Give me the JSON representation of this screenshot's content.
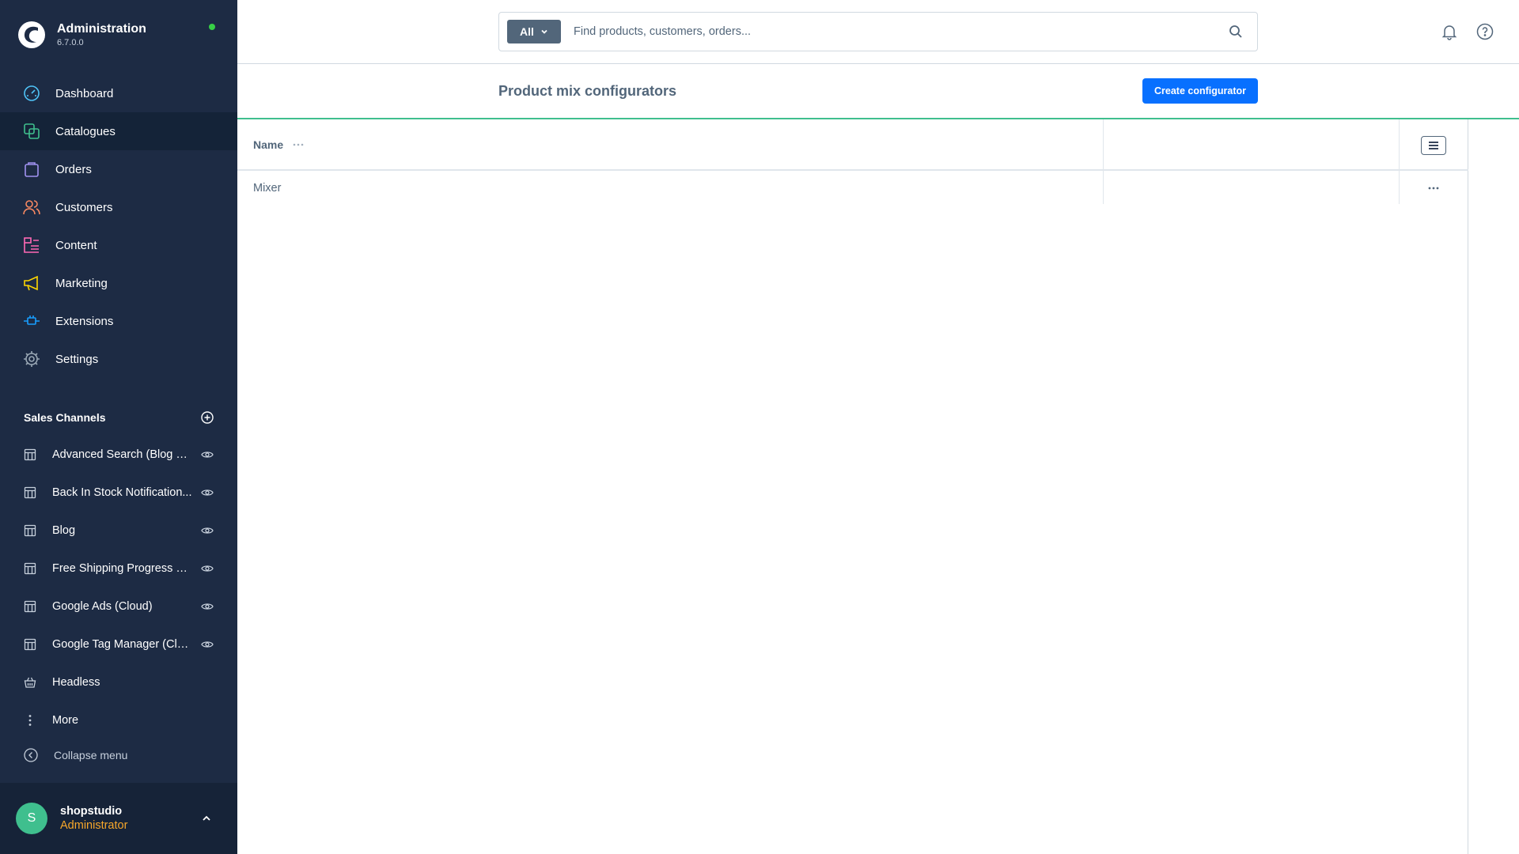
{
  "brand": {
    "title": "Administration",
    "version": "6.7.0.0",
    "status_color": "#37d046"
  },
  "nav": {
    "items": [
      {
        "label": "Dashboard",
        "icon": "dashboard-gauge-icon",
        "color": "#4fc3f7"
      },
      {
        "label": "Catalogues",
        "icon": "catalogues-icon",
        "color": "#3fbf8e"
      },
      {
        "label": "Orders",
        "icon": "orders-bag-icon",
        "color": "#a092f0"
      },
      {
        "label": "Customers",
        "icon": "customers-icon",
        "color": "#f88962"
      },
      {
        "label": "Content",
        "icon": "content-icon",
        "color": "#ff68b4"
      },
      {
        "label": "Marketing",
        "icon": "marketing-megaphone-icon",
        "color": "#ffd700"
      },
      {
        "label": "Extensions",
        "icon": "extensions-plug-icon",
        "color": "#189eff"
      },
      {
        "label": "Settings",
        "icon": "settings-gear-icon",
        "color": "#9aa8b5"
      }
    ]
  },
  "sales_channels": {
    "title": "Sales Channels",
    "items": [
      {
        "label": "Advanced Search (Blog & Ca..."
      },
      {
        "label": "Back In Stock Notification..."
      },
      {
        "label": "Blog"
      },
      {
        "label": "Free Shipping Progress Bar"
      },
      {
        "label": "Google Ads (Cloud)"
      },
      {
        "label": "Google Tag Manager (Cloud)"
      },
      {
        "label": "Headless"
      }
    ],
    "more_label": "More"
  },
  "collapse_label": "Collapse menu",
  "user": {
    "initial": "S",
    "name": "shopstudio",
    "role": "Administrator"
  },
  "search": {
    "type_label": "All",
    "placeholder": "Find products, customers, orders..."
  },
  "page": {
    "title": "Product mix configurators",
    "create_label": "Create configurator"
  },
  "grid": {
    "columns": [
      "Name"
    ],
    "rows": [
      {
        "name": "Mixer"
      }
    ]
  },
  "colors": {
    "accent": "#0870ff",
    "sidebar_bg": "#1d2b44",
    "smartbar_border": "#3fbf8e"
  }
}
